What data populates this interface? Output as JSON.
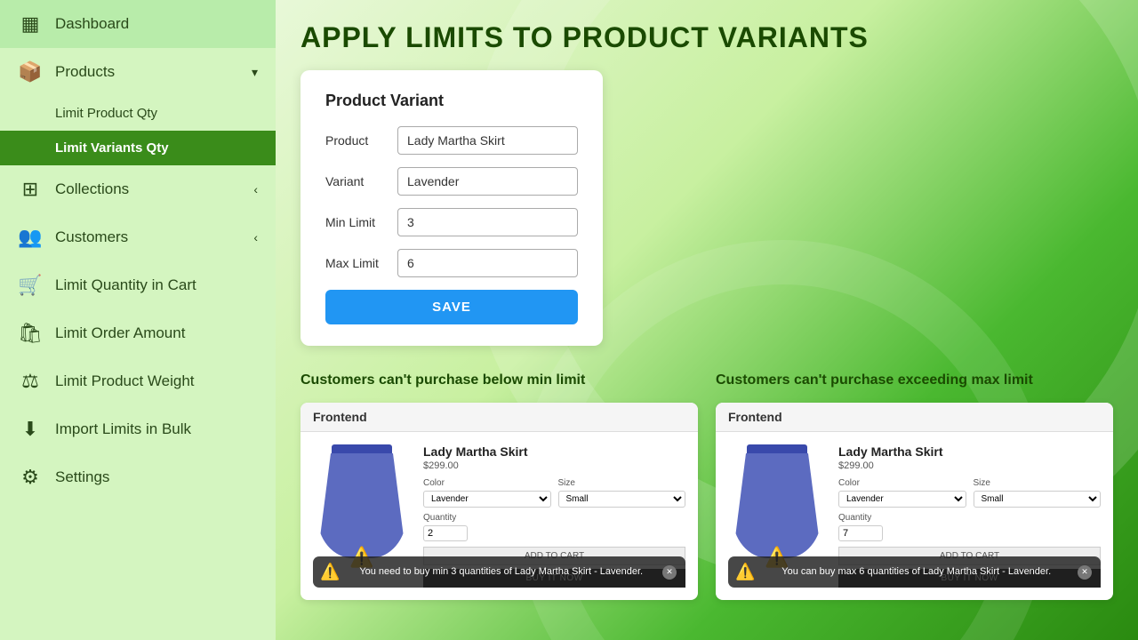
{
  "sidebar": {
    "items": [
      {
        "id": "dashboard",
        "label": "Dashboard",
        "icon": "▦",
        "active": false
      },
      {
        "id": "products",
        "label": "Products",
        "icon": "📦",
        "active": false,
        "chevron": "▾",
        "expanded": true,
        "subitems": [
          {
            "id": "limit-product-qty",
            "label": "Limit Product Qty",
            "active": false
          },
          {
            "id": "limit-variants-qty",
            "label": "Limit Variants Qty",
            "active": true
          }
        ]
      },
      {
        "id": "collections",
        "label": "Collections",
        "icon": "⊞",
        "active": false,
        "chevron": "‹"
      },
      {
        "id": "customers",
        "label": "Customers",
        "icon": "👥",
        "active": false,
        "chevron": "‹"
      },
      {
        "id": "limit-quantity-cart",
        "label": "Limit Quantity in Cart",
        "icon": "🛒",
        "active": false
      },
      {
        "id": "limit-order-amount",
        "label": "Limit Order Amount",
        "icon": "⚙",
        "active": false
      },
      {
        "id": "limit-product-weight",
        "label": "Limit Product Weight",
        "icon": "⚖",
        "active": false
      },
      {
        "id": "import-limits-bulk",
        "label": "Import Limits in Bulk",
        "icon": "⬇",
        "active": false
      },
      {
        "id": "settings",
        "label": "Settings",
        "icon": "⚙",
        "active": false
      }
    ]
  },
  "page": {
    "title": "APPLY LIMITS TO PRODUCT VARIANTS"
  },
  "variant_form": {
    "heading": "Product Variant",
    "product_label": "Product",
    "product_value": "Lady Martha Skirt",
    "variant_label": "Variant",
    "variant_value": "Lavender",
    "min_limit_label": "Min Limit",
    "min_limit_value": "3",
    "max_limit_label": "Max Limit",
    "max_limit_value": "6",
    "save_label": "SAVE"
  },
  "demos": {
    "min_label": "Customers can't purchase below min limit",
    "max_label": "Customers can't purchase exceeding max limit",
    "frontend_label": "Frontend",
    "product_name": "Lady Martha Skirt",
    "product_price": "$299.00",
    "color_label": "Color",
    "size_label": "Size",
    "color_value": "Lavender",
    "size_value": "Small",
    "quantity_label": "Quantity",
    "min_qty_value": "2",
    "max_qty_value": "7",
    "add_to_cart": "ADD TO CART",
    "buy_now": "BUY IT NOW",
    "min_warning": "You need to buy min 3 quantities of Lady Martha Skirt - Lavender.",
    "max_warning": "You can buy max 6 quantities of Lady Martha Skirt - Lavender."
  }
}
